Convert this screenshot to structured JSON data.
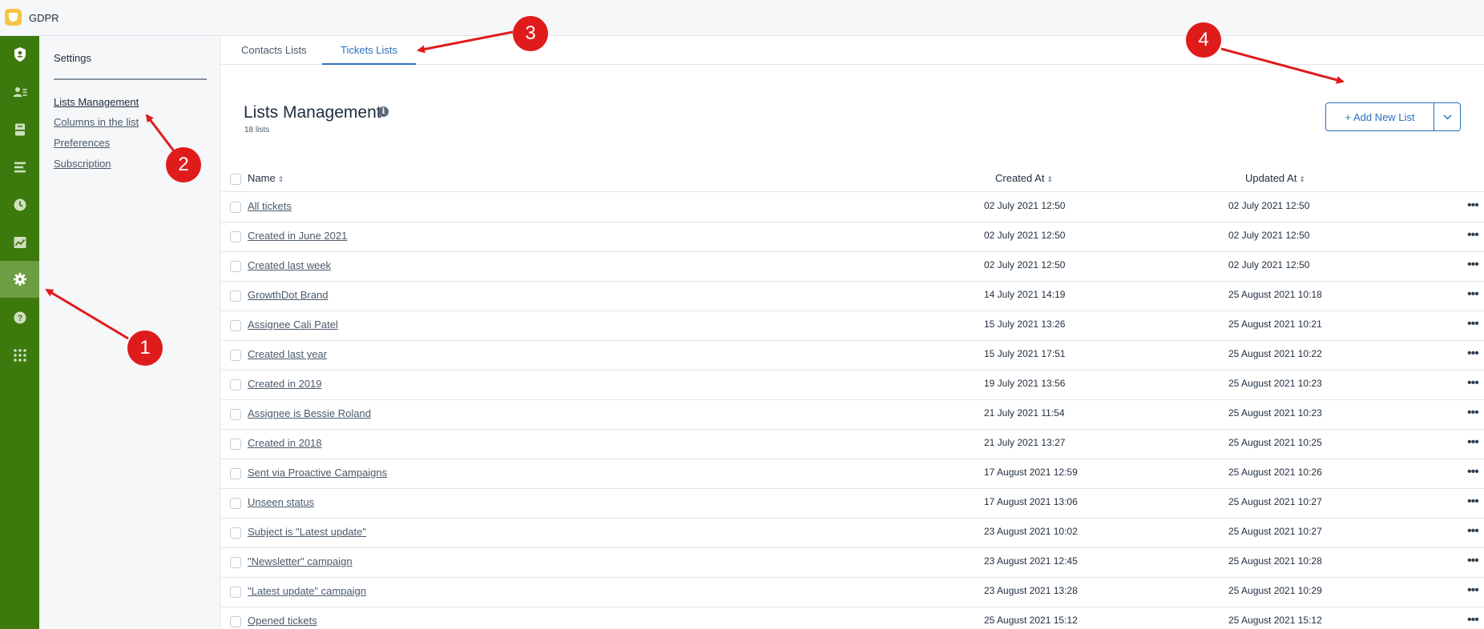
{
  "app": {
    "title": "GDPR"
  },
  "rail": {
    "items": [
      {
        "icon": "shield-user-icon"
      },
      {
        "icon": "contacts-icon"
      },
      {
        "icon": "inbox-icon"
      },
      {
        "icon": "lists-icon"
      },
      {
        "icon": "clock-icon"
      },
      {
        "icon": "reports-icon"
      },
      {
        "icon": "gear-icon",
        "active": true
      },
      {
        "icon": "help-icon"
      },
      {
        "icon": "apps-grid-icon"
      }
    ]
  },
  "sidebar": {
    "title": "Settings",
    "links": [
      {
        "label": "Lists Management",
        "active": true
      },
      {
        "label": "Columns in the list"
      },
      {
        "label": "Preferences"
      },
      {
        "label": "Subscription"
      }
    ]
  },
  "tabs": [
    {
      "label": "Contacts Lists"
    },
    {
      "label": "Tickets Lists",
      "active": true
    }
  ],
  "page": {
    "title": "Lists Management",
    "count": "18 lists",
    "add_button": "+ Add New List"
  },
  "table": {
    "headers": {
      "name": "Name",
      "created": "Created At",
      "updated": "Updated At"
    },
    "rows": [
      {
        "name": "All tickets",
        "created": "02 July 2021 12:50",
        "updated": "02 July 2021 12:50"
      },
      {
        "name": "Created in June 2021",
        "created": "02 July 2021 12:50",
        "updated": "02 July 2021 12:50"
      },
      {
        "name": "Created last week",
        "created": "02 July 2021 12:50",
        "updated": "02 July 2021 12:50"
      },
      {
        "name": "GrowthDot Brand",
        "created": "14 July 2021 14:19",
        "updated": "25 August 2021 10:18"
      },
      {
        "name": "Assignee Cali Patel",
        "created": "15 July 2021 13:26",
        "updated": "25 August 2021 10:21"
      },
      {
        "name": "Created last year",
        "created": "15 July 2021 17:51",
        "updated": "25 August 2021 10:22"
      },
      {
        "name": "Created in 2019",
        "created": "19 July 2021 13:56",
        "updated": "25 August 2021 10:23"
      },
      {
        "name": "Assignee is Bessie Roland",
        "created": "21 July 2021 11:54",
        "updated": "25 August 2021 10:23"
      },
      {
        "name": "Created in 2018",
        "created": "21 July 2021 13:27",
        "updated": "25 August 2021 10:25"
      },
      {
        "name": "Sent via Proactive Campaigns",
        "created": "17 August 2021 12:59",
        "updated": "25 August 2021 10:26"
      },
      {
        "name": "Unseen status",
        "created": "17 August 2021 13:06",
        "updated": "25 August 2021 10:27"
      },
      {
        "name": "Subject is \"Latest update\"",
        "created": "23 August 2021 10:02",
        "updated": "25 August 2021 10:27"
      },
      {
        "name": "\"Newsletter\" campaign",
        "created": "23 August 2021 12:45",
        "updated": "25 August 2021 10:28"
      },
      {
        "name": "\"Latest update\" campaign",
        "created": "23 August 2021 13:28",
        "updated": "25 August 2021 10:29"
      },
      {
        "name": "Opened tickets",
        "created": "25 August 2021 15:12",
        "updated": "25 August 2021 15:12"
      }
    ]
  },
  "annotations": {
    "color": "#e01b1b",
    "badges": [
      "1",
      "2",
      "3",
      "4"
    ]
  }
}
